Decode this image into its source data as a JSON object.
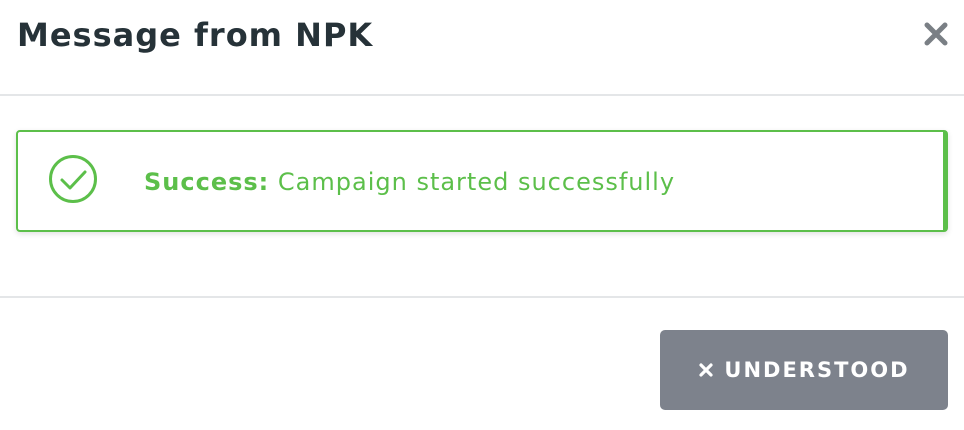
{
  "dialog": {
    "title": "Message from NPK",
    "close_icon": "close-icon"
  },
  "alert": {
    "type": "success",
    "icon": "check-circle-icon",
    "label": "Success:",
    "message": " Campaign started successfully",
    "color": "#5cbf4a"
  },
  "footer": {
    "understood_label": "UNDERSTOOD",
    "understood_icon": "close-icon",
    "button_color": "#7d828c"
  }
}
